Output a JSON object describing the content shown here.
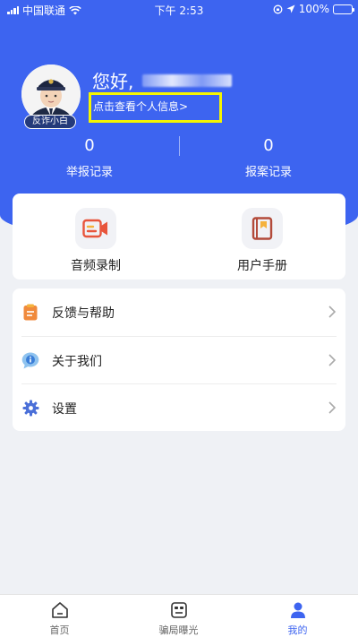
{
  "status_bar": {
    "carrier": "中国联通",
    "time": "下午 2:53",
    "battery": "100%"
  },
  "profile": {
    "greeting": "您好,",
    "avatar_tag": "反诈小白",
    "info_link": "点击查看个人信息>"
  },
  "stats": [
    {
      "value": "0",
      "label": "举报记录"
    },
    {
      "value": "0",
      "label": "报案记录"
    }
  ],
  "tools": [
    {
      "label": "音频录制",
      "icon": "video-camera-icon"
    },
    {
      "label": "用户手册",
      "icon": "book-icon"
    }
  ],
  "menu": [
    {
      "label": "反馈与帮助",
      "icon": "clipboard-icon"
    },
    {
      "label": "关于我们",
      "icon": "info-bubble-icon"
    },
    {
      "label": "设置",
      "icon": "gear-icon"
    }
  ],
  "tabbar": [
    {
      "label": "首页",
      "icon": "home-icon"
    },
    {
      "label": "骗局曝光",
      "icon": "mask-icon"
    },
    {
      "label": "我的",
      "icon": "person-icon",
      "active": true
    }
  ],
  "colors": {
    "primary": "#3d64f0",
    "highlight_box": "#f5f500",
    "tool_video": "#e8553c",
    "tool_book": "#b34a3a",
    "feedback": "#f08a3c",
    "info": "#4a90e2",
    "settings": "#4a6fd8"
  }
}
